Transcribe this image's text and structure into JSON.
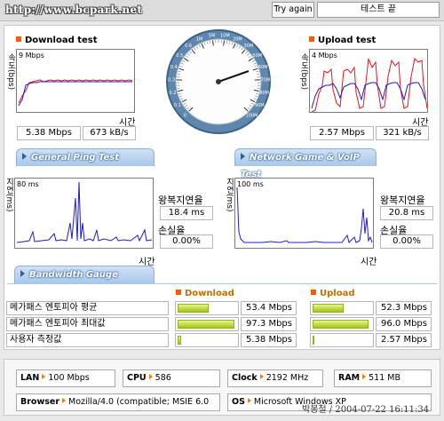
{
  "header": {
    "url": "http://www.bcpark.net",
    "try_again": "Try again",
    "status": "테스트 끝"
  },
  "download": {
    "title": "Download test",
    "ylabel": "속도(bps)",
    "scale": "9 Mbps",
    "time": "시간",
    "speed": "5.38 Mbps",
    "kbs": "673 kB/s"
  },
  "upload": {
    "title": "Upload test",
    "ylabel": "속도(bps)",
    "scale": "4 Mbps",
    "time": "시간",
    "speed": "2.57 Mbps",
    "kbs": "321 kB/s"
  },
  "gauge": {
    "ticks": [
      "0",
      "0.1",
      "0.2",
      "0.3",
      "0.4",
      "0.5",
      "0.6",
      "1M",
      "5M",
      "10M",
      "20M",
      "30M",
      "50M",
      "60M",
      "70M",
      "80M",
      "90M",
      "100M"
    ],
    "needle_value": "5.38 Mbps"
  },
  "tabs": {
    "ping": "General Ping Test",
    "game": "Network Game & VoIP Test",
    "bandwidth": "Bandwidth Gauge"
  },
  "ping": {
    "ylabel": "지연(ms)",
    "scale": "80 ms",
    "time": "시간",
    "latency_label": "왕복지연율",
    "latency": "18.4 ms",
    "loss_label": "손실율",
    "loss": "0.00%"
  },
  "game": {
    "ylabel": "지연(ms)",
    "scale": "100 ms",
    "time": "시간",
    "latency_label": "왕복지연율",
    "latency": "20.8 ms",
    "loss_label": "손실율",
    "loss": "0.00%"
  },
  "bandwidth": {
    "download_header": "Download",
    "upload_header": "Upload",
    "rows": [
      {
        "label": "메가패스 엔토피아 평균",
        "dl_value": "53.4 Mbps",
        "dl_fraction": 0.534,
        "ul_value": "52.3 Mbps",
        "ul_fraction": 0.523
      },
      {
        "label": "메가패스 엔토피아 최대값",
        "dl_value": "97.3 Mbps",
        "dl_fraction": 0.973,
        "ul_value": "96.0 Mbps",
        "ul_fraction": 0.96
      },
      {
        "label": "사용자 측정값",
        "dl_value": "5.38 Mbps",
        "dl_fraction": 0.054,
        "ul_value": "2.57 Mbps",
        "ul_fraction": 0.026
      }
    ]
  },
  "system": {
    "lan_key": "LAN",
    "lan": "100 Mbps",
    "cpu_key": "CPU",
    "cpu": "586",
    "clock_key": "Clock",
    "clock": "2192 MHz",
    "ram_key": "RAM",
    "ram": "511 MB",
    "browser_key": "Browser",
    "browser": "Mozilla/4.0 (compatible; MSIE 6.0",
    "os_key": "OS",
    "os": "Microsoft Windows XP"
  },
  "footer": {
    "signature": "박봉철 / 2004-07-22 16:11:34"
  },
  "colors": {
    "accent_orange": "#ff5a00",
    "tab_blue": "#a9c7ea",
    "series_red": "#e8141c",
    "series_blue": "#1c1cc8",
    "bar_green": "#9fc615"
  }
}
